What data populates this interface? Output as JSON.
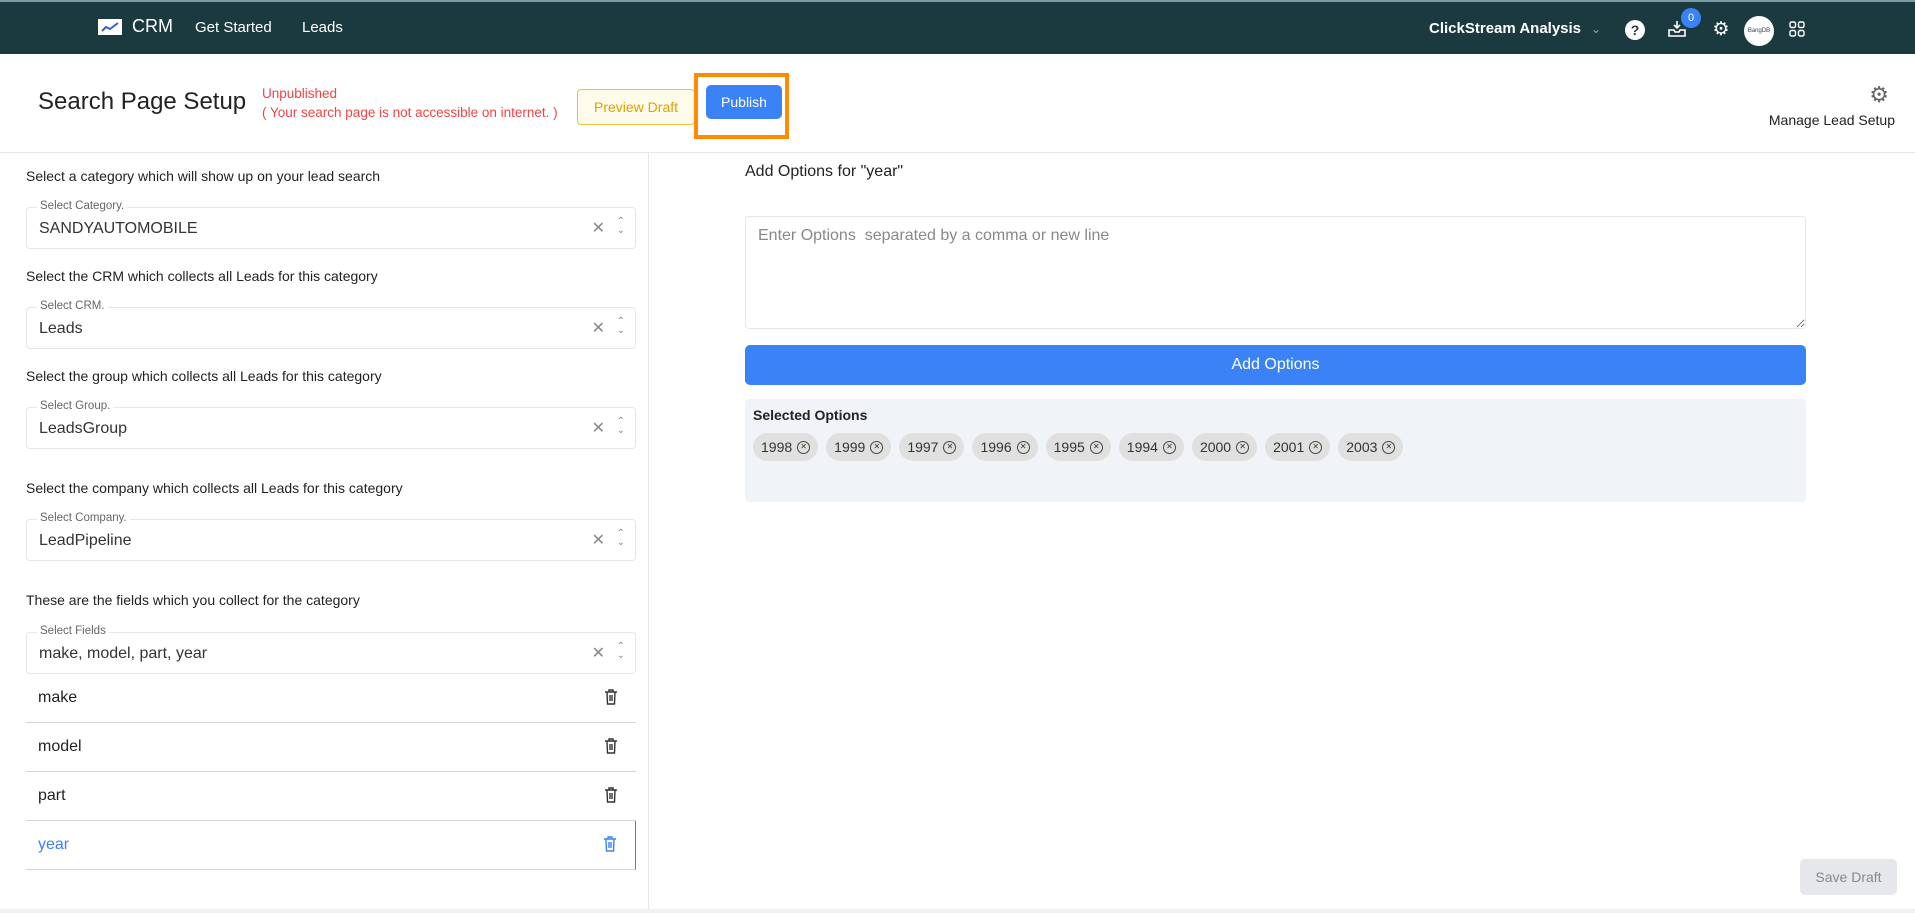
{
  "topbar": {
    "brand": "CRM",
    "nav": [
      "Get Started",
      "Leads"
    ],
    "workspace": "ClickStream Analysis",
    "notification_count": "0",
    "avatar_text": "BangDB"
  },
  "header": {
    "title": "Search Page Setup",
    "status": "Unpublished",
    "status_note": "( Your search page is not accessible on internet. )",
    "preview_label": "Preview Draft",
    "publish_label": "Publish",
    "manage_label": "Manage Lead Setup"
  },
  "left": {
    "category": {
      "label": "Select a category which will show up on your lead search",
      "legend": "Select Category.",
      "value": "SANDYAUTOMOBILE"
    },
    "crm": {
      "label": "Select the CRM which collects all Leads for this category",
      "legend": "Select CRM.",
      "value": "Leads"
    },
    "group": {
      "label": "Select the group which collects all Leads for this category",
      "legend": "Select Group.",
      "value": "LeadsGroup"
    },
    "company": {
      "label": "Select the company which collects all Leads for this category",
      "legend": "Select Company.",
      "value": "LeadPipeline"
    },
    "fields": {
      "label": "These are the fields which you collect for the category",
      "legend": "Select Fields",
      "value": "make, model, part, year"
    },
    "field_rows": [
      "make",
      "model",
      "part",
      "year"
    ]
  },
  "right": {
    "title": "Add Options for \"year\"",
    "placeholder": "Enter Options  separated by a comma or new line",
    "add_label": "Add Options",
    "selected_title": "Selected Options",
    "chips": [
      "1998",
      "1999",
      "1997",
      "1996",
      "1995",
      "1994",
      "2000",
      "2001",
      "2003"
    ]
  },
  "footer": {
    "save_draft_label": "Save Draft"
  },
  "colors": {
    "topbar": "#1b3a40",
    "accent": "#3b82f6",
    "error": "#ef4444",
    "highlight": "#ff8c00"
  }
}
